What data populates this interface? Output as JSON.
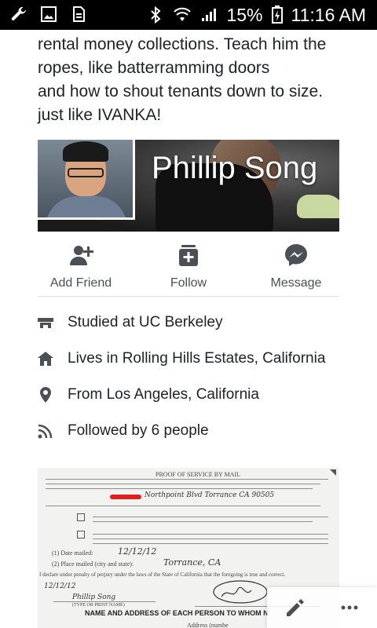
{
  "status_bar": {
    "battery": "15%",
    "time": "11:16 AM",
    "icons_left": [
      "wrench-icon",
      "image-icon",
      "sim-icon"
    ],
    "icons_right": [
      "bluetooth-icon",
      "wifi-icon",
      "signal-icon",
      "battery-icon"
    ]
  },
  "post": {
    "lines": [
      "rental money collections.  Teach him the",
      "ropes, like batterramming doors",
      "and how to shout tenants down to size.",
      " just like IVANKA!"
    ]
  },
  "profile": {
    "name": "Phillip Song"
  },
  "actions": [
    {
      "label": "Add Friend",
      "icon": "add-friend-icon"
    },
    {
      "label": "Follow",
      "icon": "follow-icon"
    },
    {
      "label": "Message",
      "icon": "messenger-icon"
    }
  ],
  "info": [
    {
      "text": "Studied at UC Berkeley",
      "icon": "education-icon"
    },
    {
      "text": "Lives in Rolling Hills Estates, California",
      "icon": "home-icon"
    },
    {
      "text": "From Los Angeles, California",
      "icon": "location-pin-icon"
    },
    {
      "text": "Followed by 6 people",
      "icon": "rss-icon"
    }
  ],
  "document": {
    "header": "PROOF OF SERVICE BY MAIL",
    "address_handwritten": "Northpoint Blvd  Torrance CA 90505",
    "date_handwritten": "12/12/12",
    "place_handwritten": "Torrance, CA",
    "signer_handwritten": "Phillip Song",
    "type_label": "(TYPE OR PRINT NAME)",
    "perjury": "I declare under penalty of perjury under the laws of the State of California that the foregoing is true and correct.",
    "date_mailed_label": "(1) Date mailed:",
    "place_mailed_label": "(2) Place mailed (city and state):",
    "footer": "NAME AND ADDRESS OF EACH PERSON TO WHOM N",
    "address_label": "Address (numbe"
  },
  "colors": {
    "icon": "#4b4f56",
    "text": "#1d2129",
    "divider": "#dddfe2"
  }
}
